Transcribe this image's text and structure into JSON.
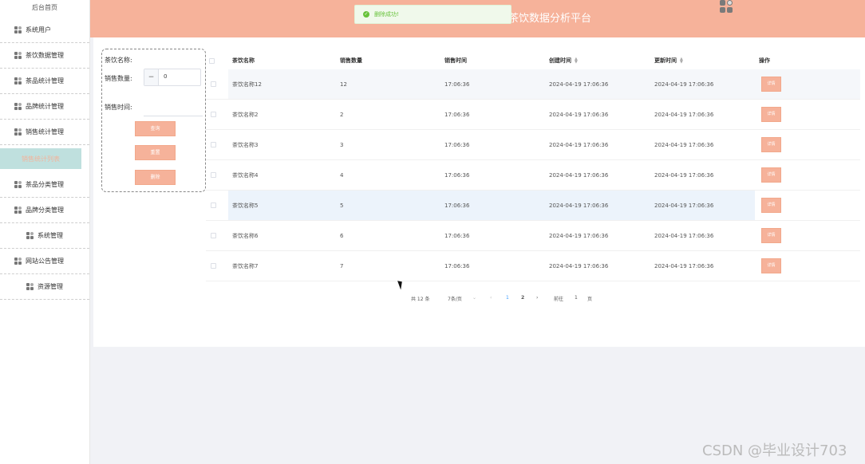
{
  "sidebar": {
    "home": "后台首页",
    "items": [
      {
        "label": "系统用户"
      },
      {
        "label": "茶饮数据管理"
      },
      {
        "label": "茶品统计管理"
      },
      {
        "label": "品牌统计管理"
      },
      {
        "label": "销售统计管理"
      },
      {
        "label": "销售统计列表"
      },
      {
        "label": "茶品分类管理"
      },
      {
        "label": "品牌分类管理"
      },
      {
        "label": "系统管理"
      },
      {
        "label": "网站公告管理"
      },
      {
        "label": "资源管理"
      }
    ]
  },
  "header": {
    "title": "茶饮数据分析平台"
  },
  "toast": {
    "message": "删除成功!"
  },
  "search": {
    "name_label": "茶饮名称:",
    "qty_label": "销售数量:",
    "qty_minus": "−",
    "qty_value": "0",
    "time_label": "销售时间:",
    "query_button": "查询",
    "reset_button": "重置",
    "delete_button": "删除"
  },
  "table": {
    "columns": [
      "茶饮名称",
      "销售数量",
      "销售时间",
      "创建时间",
      "更新时间",
      "操作"
    ],
    "rows": [
      {
        "name": "茶饮名称12",
        "qty": "12",
        "time": "17:06:36",
        "created": "2024-04-19 17:06:36",
        "updated": "2024-04-19 17:06:36",
        "action": "详情"
      },
      {
        "name": "茶饮名称2",
        "qty": "2",
        "time": "17:06:36",
        "created": "2024-04-19 17:06:36",
        "updated": "2024-04-19 17:06:36",
        "action": "详情"
      },
      {
        "name": "茶饮名称3",
        "qty": "3",
        "time": "17:06:36",
        "created": "2024-04-19 17:06:36",
        "updated": "2024-04-19 17:06:36",
        "action": "详情"
      },
      {
        "name": "茶饮名称4",
        "qty": "4",
        "time": "17:06:36",
        "created": "2024-04-19 17:06:36",
        "updated": "2024-04-19 17:06:36",
        "action": "详情"
      },
      {
        "name": "茶饮名称5",
        "qty": "5",
        "time": "17:06:36",
        "created": "2024-04-19 17:06:36",
        "updated": "2024-04-19 17:06:36",
        "action": "详情"
      },
      {
        "name": "茶饮名称6",
        "qty": "6",
        "time": "17:06:36",
        "created": "2024-04-19 17:06:36",
        "updated": "2024-04-19 17:06:36",
        "action": "详情"
      },
      {
        "name": "茶饮名称7",
        "qty": "7",
        "time": "17:06:36",
        "created": "2024-04-19 17:06:36",
        "updated": "2024-04-19 17:06:36",
        "action": "详情"
      }
    ]
  },
  "pagination": {
    "total": "共 12 条",
    "page_size": "7条/页",
    "page_size_arrow": "⌄",
    "prev": "‹",
    "pages": [
      "1",
      "2"
    ],
    "next": "›",
    "goto_prefix": "前往",
    "goto_value": "1",
    "goto_suffix": "页"
  },
  "watermark": "CSDN @毕业设计703"
}
